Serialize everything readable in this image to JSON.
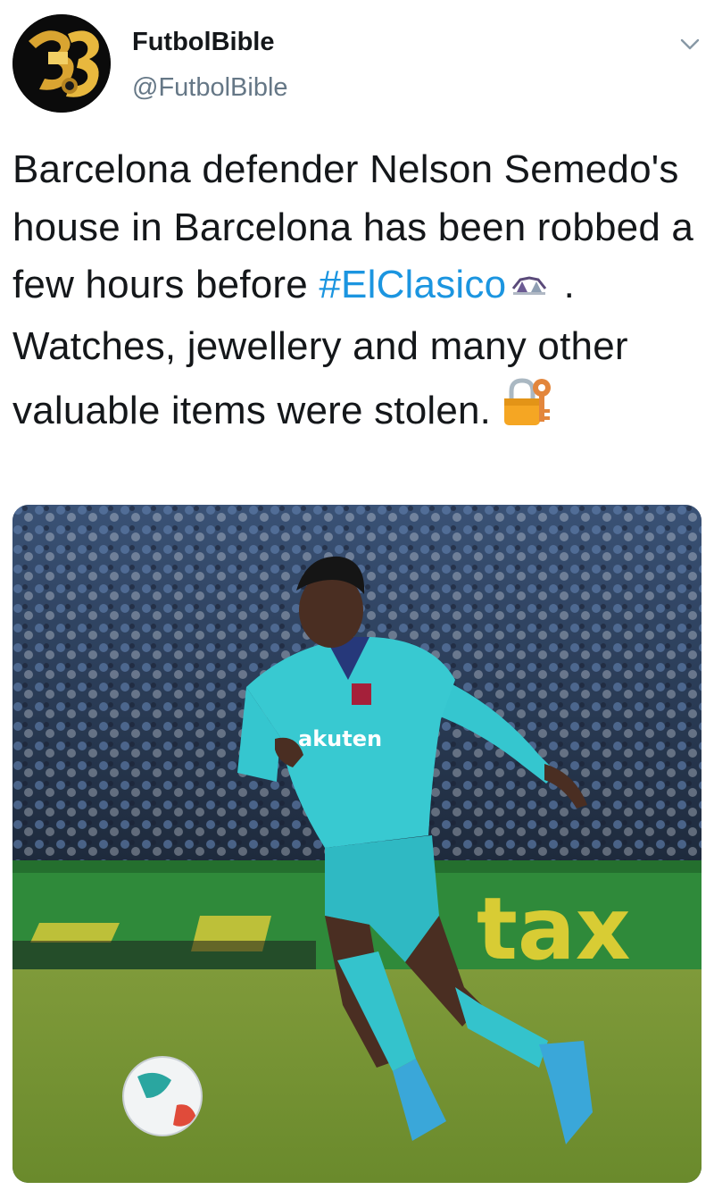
{
  "account": {
    "display_name": "FutbolBible",
    "handle": "@FutbolBible",
    "avatar_icon": "futbolbible-logo-icon"
  },
  "menu": {
    "icon": "chevron-down-icon"
  },
  "tweet": {
    "text_part1": "Barcelona defender Nelson Semedo's house in Barcelona has been robbed a few hours before ",
    "hashtag": "#ElClasico",
    "hashtag_emoji": "stadium-emoji-icon",
    "text_part2": " . Watches, jewellery and many other valuable items were stolen. ",
    "end_emoji": "locked-with-key-emoji-icon"
  },
  "media": {
    "description_icon": "football-photo",
    "board_text": "tax",
    "shirt_text": "akuten"
  },
  "colors": {
    "link": "#1b95e0",
    "text": "#14171a",
    "secondary": "#657786"
  }
}
